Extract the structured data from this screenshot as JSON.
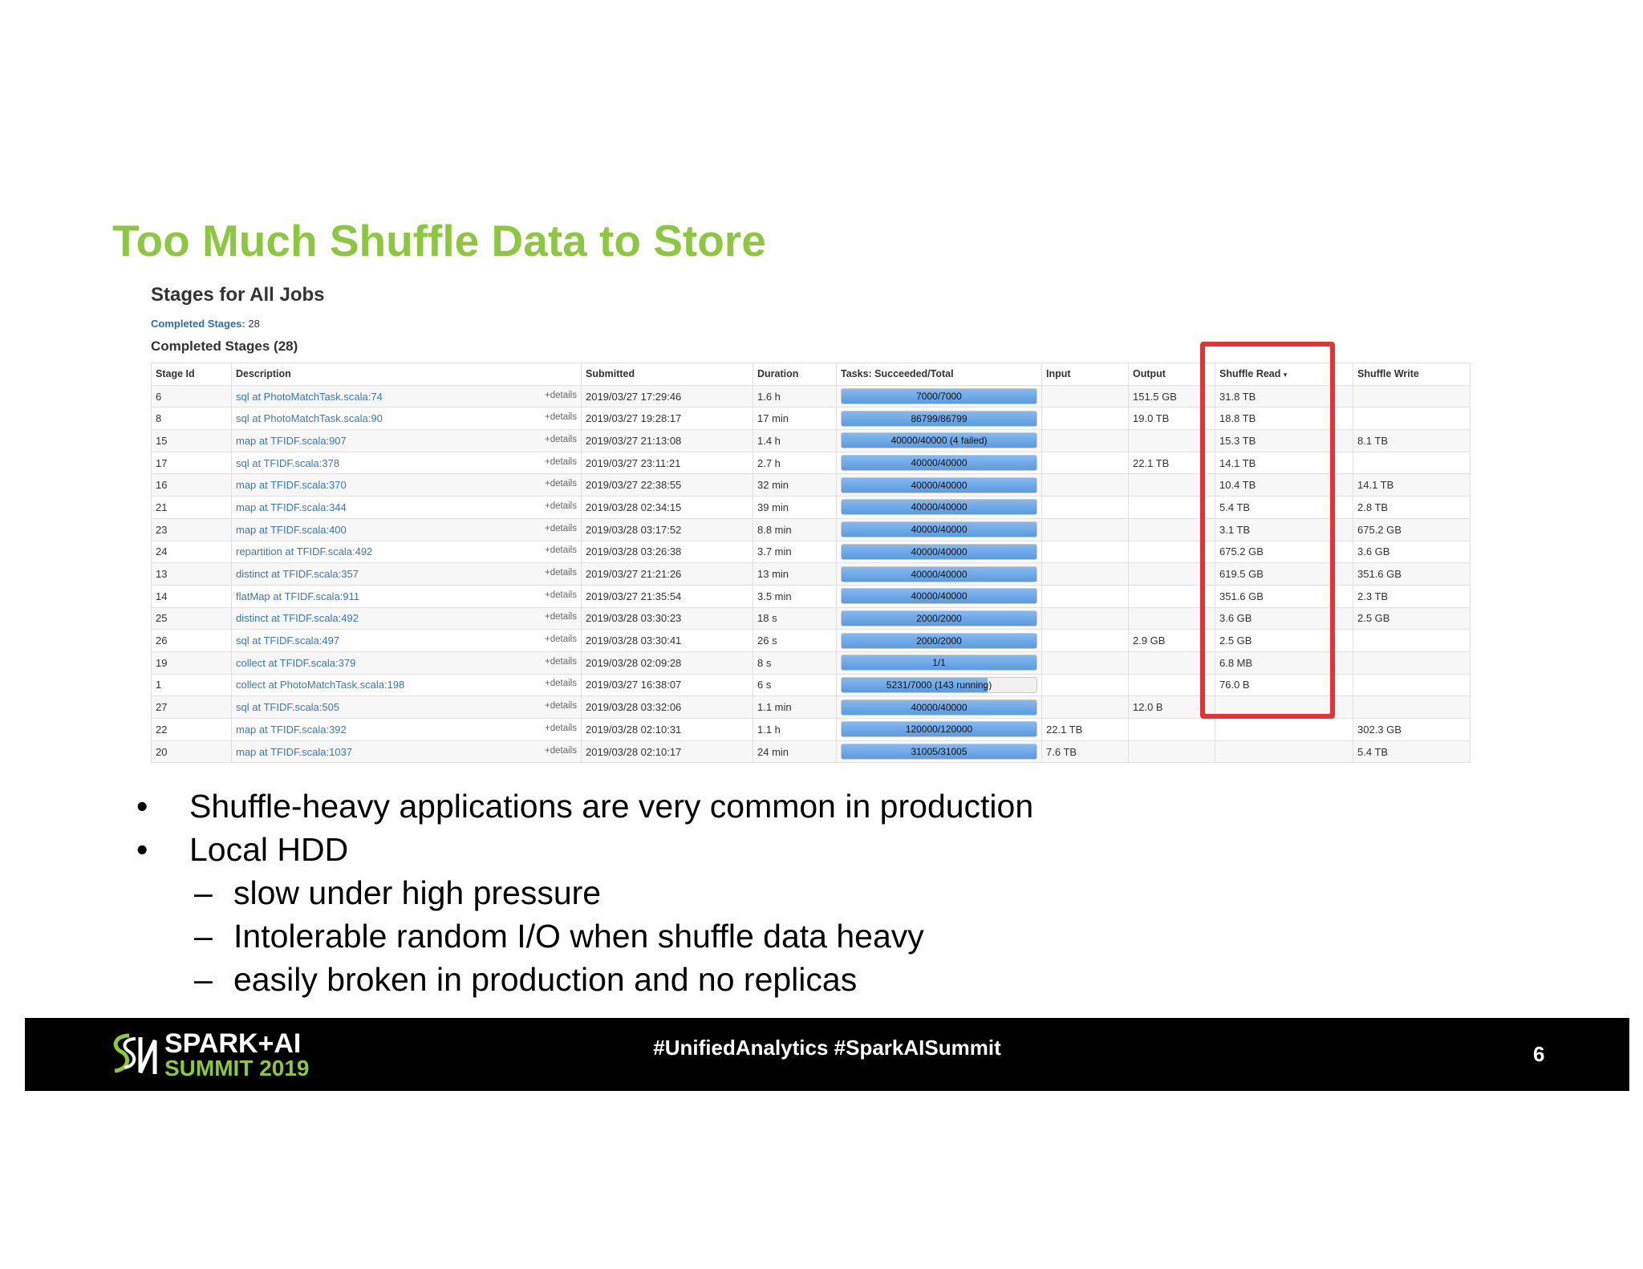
{
  "slide": {
    "title": "Too Much Shuffle Data to Store",
    "bullets": [
      {
        "text": "Shuffle-heavy applications are very common in production",
        "sub": []
      },
      {
        "text": "Local HDD",
        "sub": [
          "slow under high pressure",
          "Intolerable random I/O when shuffle data heavy",
          "easily broken in production and no replicas"
        ]
      }
    ],
    "bullet_mark": "•",
    "sub_mark": "–"
  },
  "spark_ui": {
    "page_title": "Stages for All Jobs",
    "completed_link_label": "Completed Stages:",
    "completed_count": "28",
    "section_heading": "Completed Stages (28)",
    "details_label": "+details",
    "sort_indicator": "▾",
    "columns": [
      "Stage Id",
      "Description",
      "Submitted",
      "Duration",
      "Tasks: Succeeded/Total",
      "Input",
      "Output",
      "Shuffle Read",
      "Shuffle Write"
    ],
    "rows": [
      {
        "id": "6",
        "desc": "sql at PhotoMatchTask.scala:74",
        "submitted": "2019/03/27 17:29:46",
        "duration": "1.6 h",
        "tasks": "7000/7000",
        "progress": 1,
        "input": "",
        "output": "151.5 GB",
        "shuffle_read": "31.8 TB",
        "shuffle_write": ""
      },
      {
        "id": "8",
        "desc": "sql at PhotoMatchTask.scala:90",
        "submitted": "2019/03/27 19:28:17",
        "duration": "17 min",
        "tasks": "86799/86799",
        "progress": 1,
        "input": "",
        "output": "19.0 TB",
        "shuffle_read": "18.8 TB",
        "shuffle_write": ""
      },
      {
        "id": "15",
        "desc": "map at TFIDF.scala:907",
        "submitted": "2019/03/27 21:13:08",
        "duration": "1.4 h",
        "tasks": "40000/40000 (4 failed)",
        "progress": 1,
        "input": "",
        "output": "",
        "shuffle_read": "15.3 TB",
        "shuffle_write": "8.1 TB"
      },
      {
        "id": "17",
        "desc": "sql at TFIDF.scala:378",
        "submitted": "2019/03/27 23:11:21",
        "duration": "2.7 h",
        "tasks": "40000/40000",
        "progress": 1,
        "input": "",
        "output": "22.1 TB",
        "shuffle_read": "14.1 TB",
        "shuffle_write": ""
      },
      {
        "id": "16",
        "desc": "map at TFIDF.scala:370",
        "submitted": "2019/03/27 22:38:55",
        "duration": "32 min",
        "tasks": "40000/40000",
        "progress": 1,
        "input": "",
        "output": "",
        "shuffle_read": "10.4 TB",
        "shuffle_write": "14.1 TB"
      },
      {
        "id": "21",
        "desc": "map at TFIDF.scala:344",
        "submitted": "2019/03/28 02:34:15",
        "duration": "39 min",
        "tasks": "40000/40000",
        "progress": 1,
        "input": "",
        "output": "",
        "shuffle_read": "5.4 TB",
        "shuffle_write": "2.8 TB"
      },
      {
        "id": "23",
        "desc": "map at TFIDF.scala:400",
        "submitted": "2019/03/28 03:17:52",
        "duration": "8.8 min",
        "tasks": "40000/40000",
        "progress": 1,
        "input": "",
        "output": "",
        "shuffle_read": "3.1 TB",
        "shuffle_write": "675.2 GB"
      },
      {
        "id": "24",
        "desc": "repartition at TFIDF.scala:492",
        "submitted": "2019/03/28 03:26:38",
        "duration": "3.7 min",
        "tasks": "40000/40000",
        "progress": 1,
        "input": "",
        "output": "",
        "shuffle_read": "675.2 GB",
        "shuffle_write": "3.6 GB"
      },
      {
        "id": "13",
        "desc": "distinct at TFIDF.scala:357",
        "submitted": "2019/03/27 21:21:26",
        "duration": "13 min",
        "tasks": "40000/40000",
        "progress": 1,
        "input": "",
        "output": "",
        "shuffle_read": "619.5 GB",
        "shuffle_write": "351.6 GB"
      },
      {
        "id": "14",
        "desc": "flatMap at TFIDF.scala:911",
        "submitted": "2019/03/27 21:35:54",
        "duration": "3.5 min",
        "tasks": "40000/40000",
        "progress": 1,
        "input": "",
        "output": "",
        "shuffle_read": "351.6 GB",
        "shuffle_write": "2.3 TB"
      },
      {
        "id": "25",
        "desc": "distinct at TFIDF.scala:492",
        "submitted": "2019/03/28 03:30:23",
        "duration": "18 s",
        "tasks": "2000/2000",
        "progress": 1,
        "input": "",
        "output": "",
        "shuffle_read": "3.6 GB",
        "shuffle_write": "2.5 GB"
      },
      {
        "id": "26",
        "desc": "sql at TFIDF.scala:497",
        "submitted": "2019/03/28 03:30:41",
        "duration": "26 s",
        "tasks": "2000/2000",
        "progress": 1,
        "input": "",
        "output": "2.9 GB",
        "shuffle_read": "2.5 GB",
        "shuffle_write": ""
      },
      {
        "id": "19",
        "desc": "collect at TFIDF.scala:379",
        "submitted": "2019/03/28 02:09:28",
        "duration": "8 s",
        "tasks": "1/1",
        "progress": 1,
        "input": "",
        "output": "",
        "shuffle_read": "6.8 MB",
        "shuffle_write": ""
      },
      {
        "id": "1",
        "desc": "collect at PhotoMatchTask.scala:198",
        "submitted": "2019/03/27 16:38:07",
        "duration": "6 s",
        "tasks": "5231/7000 (143 running)",
        "progress": 0.75,
        "input": "",
        "output": "",
        "shuffle_read": "76.0 B",
        "shuffle_write": ""
      },
      {
        "id": "27",
        "desc": "sql at TFIDF.scala:505",
        "submitted": "2019/03/28 03:32:06",
        "duration": "1.1 min",
        "tasks": "40000/40000",
        "progress": 1,
        "input": "",
        "output": "12.0 B",
        "shuffle_read": "",
        "shuffle_write": ""
      },
      {
        "id": "22",
        "desc": "map at TFIDF.scala:392",
        "submitted": "2019/03/28 02:10:31",
        "duration": "1.1 h",
        "tasks": "120000/120000",
        "progress": 1,
        "input": "22.1 TB",
        "output": "",
        "shuffle_read": "",
        "shuffle_write": "302.3 GB"
      },
      {
        "id": "20",
        "desc": "map at TFIDF.scala:1037",
        "submitted": "2019/03/28 02:10:17",
        "duration": "24 min",
        "tasks": "31005/31005",
        "progress": 1,
        "input": "7.6 TB",
        "output": "",
        "shuffle_read": "",
        "shuffle_write": "5.4 TB"
      }
    ],
    "highlight_color": "#e53333"
  },
  "footer": {
    "logo_line1": "SPARK+AI",
    "logo_line2": "SUMMIT 2019",
    "hashtags": "#UnifiedAnalytics #SparkAISummit",
    "page_number": "6",
    "accent": "#8dc63f"
  }
}
